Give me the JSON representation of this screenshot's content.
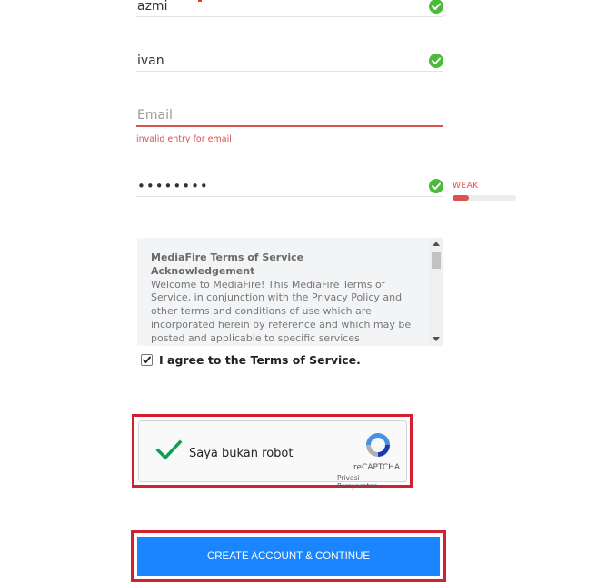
{
  "form": {
    "first_name": "azmi",
    "last_name": "ivan",
    "email_placeholder": "Email",
    "email_error": "invalid entry for email",
    "password_masked": "••••••••",
    "password_strength": {
      "label": "WEAK",
      "level_percent": 25
    }
  },
  "terms": {
    "title_line1": "MediaFire Terms of Service",
    "title_line2": "Acknowledgement",
    "body": "Welcome to MediaFire! This MediaFire Terms of Service, in conjunction with the Privacy Policy and other terms and conditions of use which are incorporated herein by reference and which may be posted and applicable to specific services (collectively, the \"Agreement\") governs",
    "agree_label": "I agree to the Terms of Service.",
    "agree_checked": true
  },
  "captcha": {
    "label": "Saya bukan robot",
    "brand": "reCAPTCHA",
    "links": "Privasi - Persyaratan"
  },
  "submit": {
    "label": "CREATE ACCOUNT & CONTINUE"
  },
  "colors": {
    "accent_blue": "#1a85ff",
    "error_red": "#d9534f",
    "success_green": "#4cbb3a",
    "highlight_red": "#d32030"
  }
}
